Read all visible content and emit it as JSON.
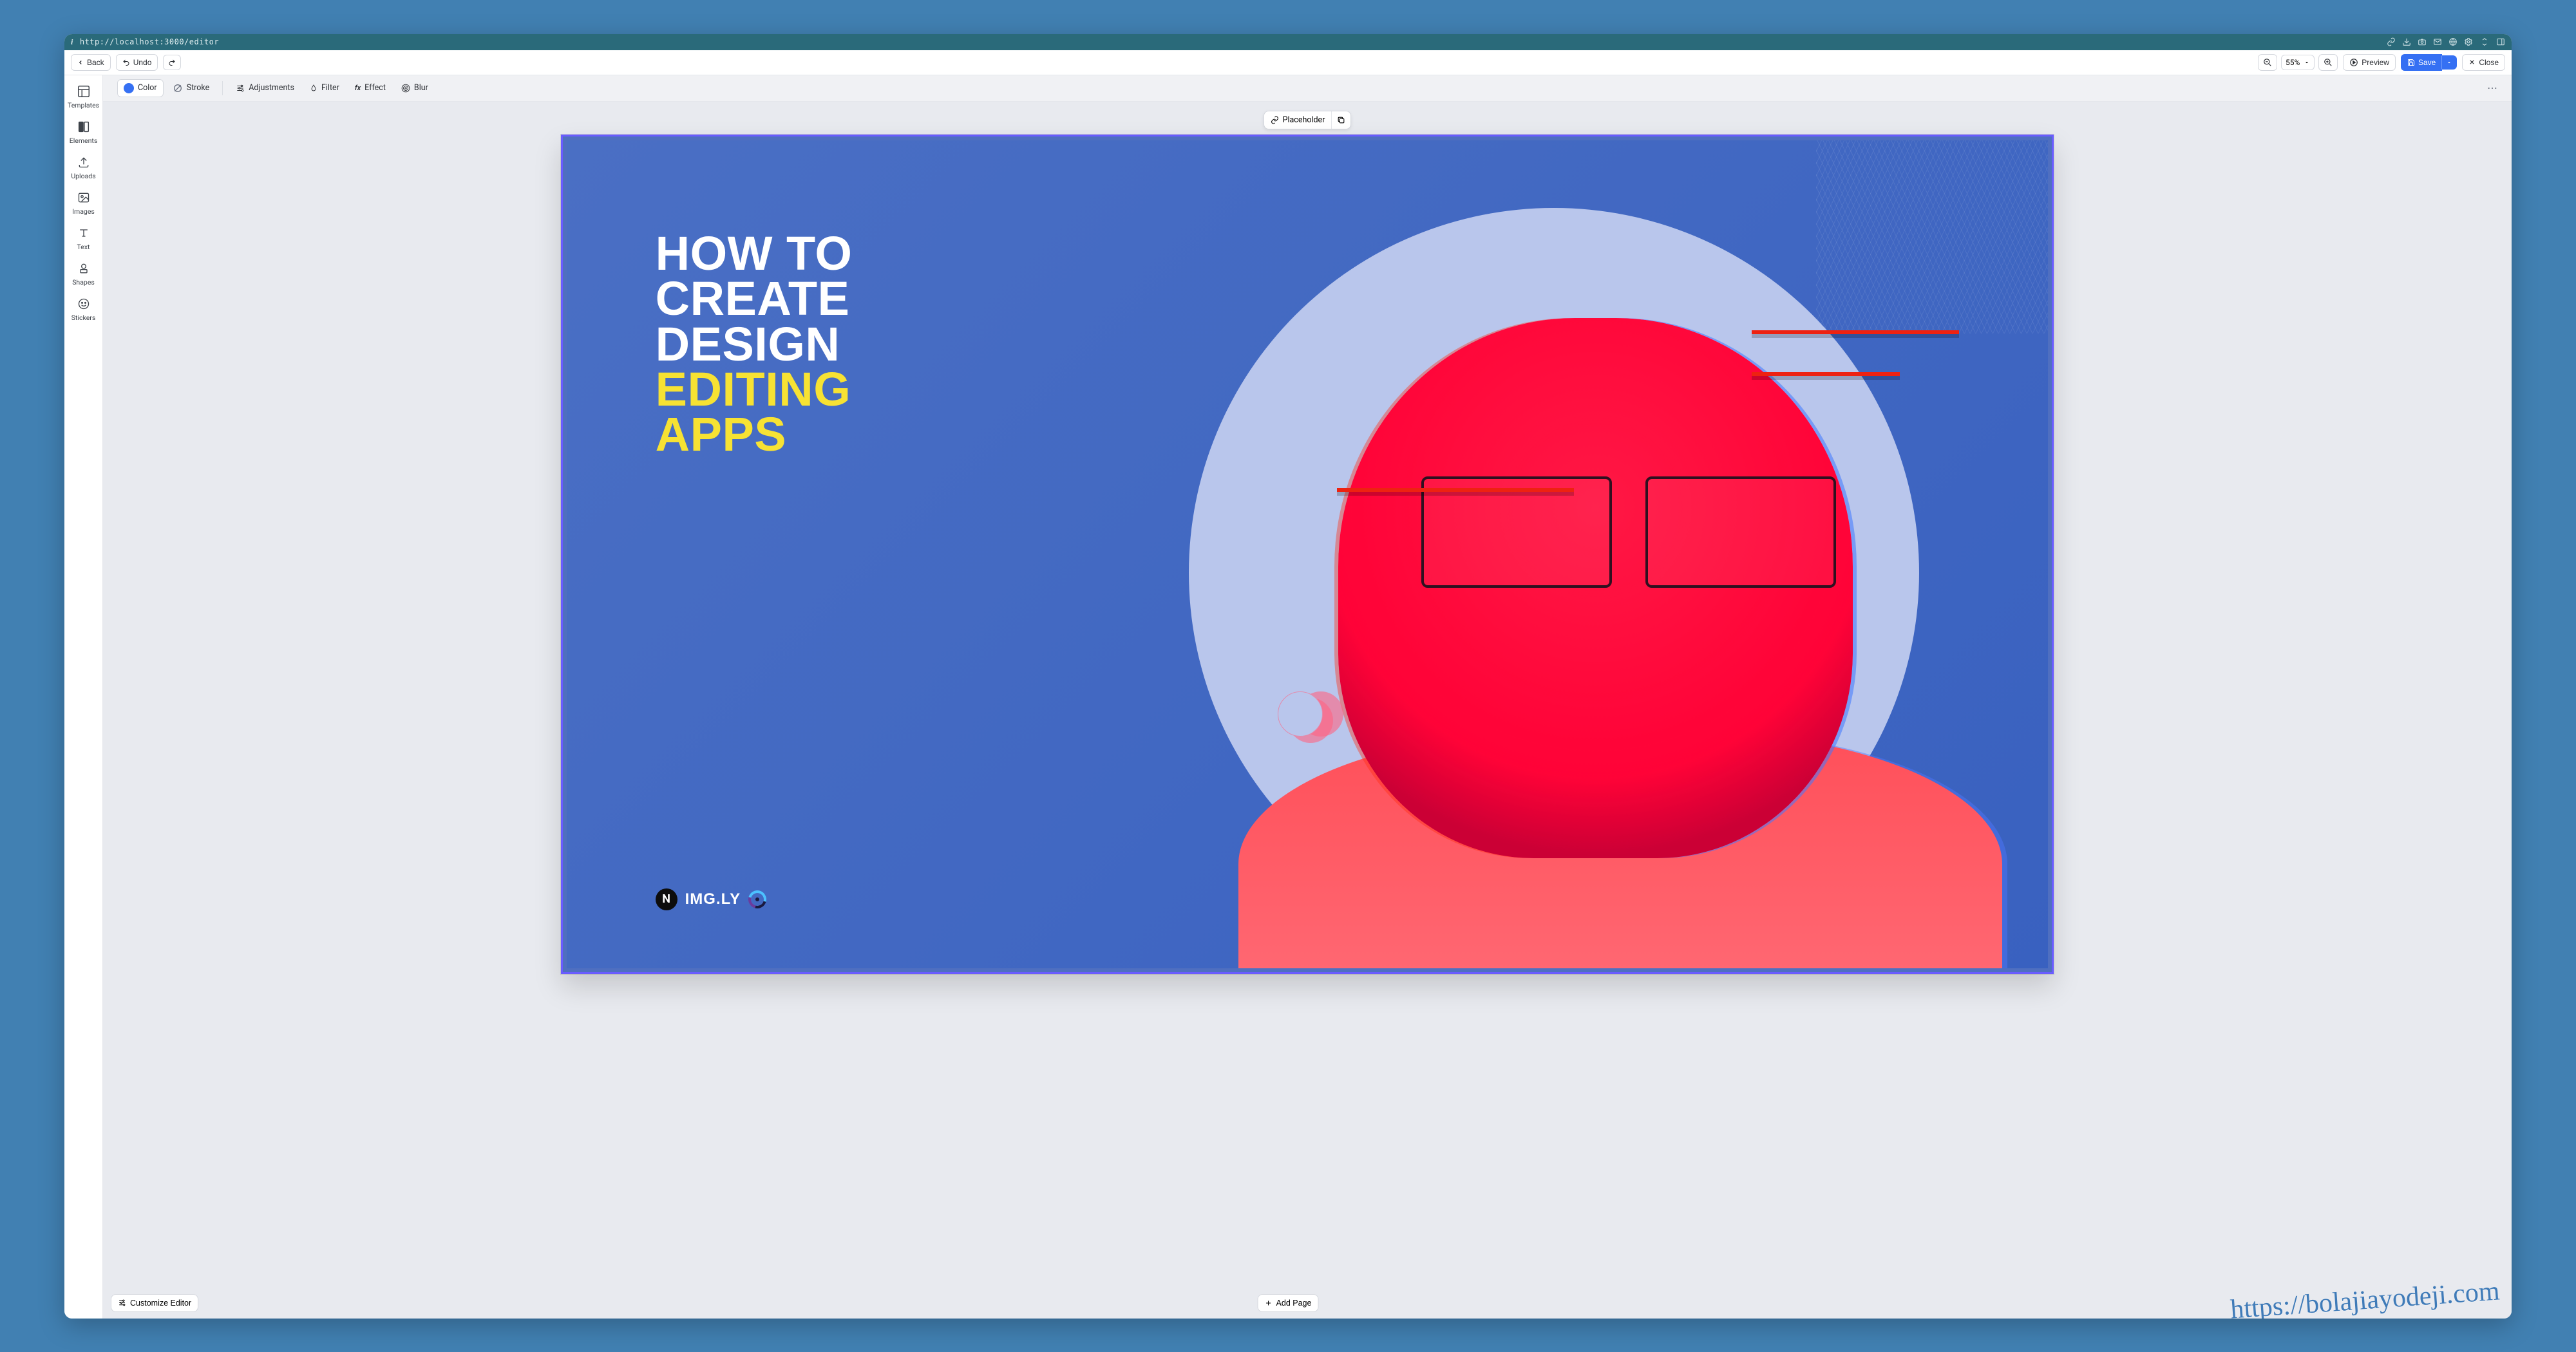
{
  "url": "http://localhost:3000/editor",
  "toolbar": {
    "back": "Back",
    "undo": "Undo",
    "zoom": "55%",
    "preview": "Preview",
    "save": "Save",
    "close": "Close"
  },
  "context": {
    "color": "Color",
    "stroke": "Stroke",
    "adjustments": "Adjustments",
    "filter": "Filter",
    "effect": "Effect",
    "blur": "Blur"
  },
  "sidebar": [
    {
      "id": "templates",
      "label": "Templates"
    },
    {
      "id": "elements",
      "label": "Elements"
    },
    {
      "id": "uploads",
      "label": "Uploads"
    },
    {
      "id": "images",
      "label": "Images"
    },
    {
      "id": "text",
      "label": "Text"
    },
    {
      "id": "shapes",
      "label": "Shapes"
    },
    {
      "id": "stickers",
      "label": "Stickers"
    }
  ],
  "floating": {
    "placeholder": "Placeholder"
  },
  "canvas": {
    "headline1": "HOW TO",
    "headline2": "CREATE",
    "headline3": "DESIGN",
    "headline4": "EDITING",
    "headline5": "APPS",
    "logo_text": "IMG.LY"
  },
  "footer": {
    "customize": "Customize Editor",
    "add_page": "Add Page"
  },
  "watermark": "https://bolajiayodeji.com"
}
